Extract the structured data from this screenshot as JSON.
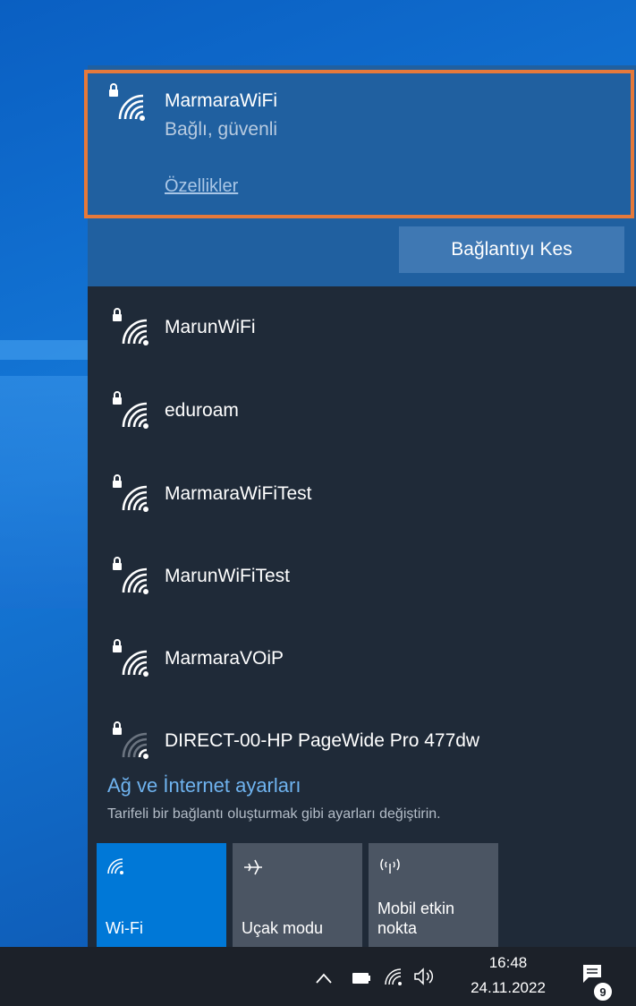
{
  "connected_network": {
    "name": "MarmaraWiFi",
    "status": "Bağlı, güvenli",
    "properties_link": "Özellikler",
    "disconnect_button": "Bağlantıyı Kes"
  },
  "networks": [
    {
      "name": "MarunWiFi",
      "secured": true,
      "signal": "full"
    },
    {
      "name": "eduroam",
      "secured": true,
      "signal": "full"
    },
    {
      "name": "MarmaraWiFiTest",
      "secured": true,
      "signal": "full"
    },
    {
      "name": "MarunWiFiTest",
      "secured": true,
      "signal": "full"
    },
    {
      "name": "MarmaraVOiP",
      "secured": true,
      "signal": "full"
    },
    {
      "name": "DIRECT-00-HP PageWide Pro 477dw",
      "secured": true,
      "signal": "weak"
    }
  ],
  "settings": {
    "link": "Ağ ve İnternet ayarları",
    "description": "Tarifeli bir bağlantı oluşturmak gibi ayarları değiştirin."
  },
  "quick_actions": [
    {
      "label": "Wi-Fi",
      "icon": "wifi-icon",
      "active": true
    },
    {
      "label": "Uçak modu",
      "icon": "airplane-icon",
      "active": false
    },
    {
      "label_line1": "Mobil etkin",
      "label_line2": "nokta",
      "icon": "mobile-hotspot-icon",
      "active": false
    }
  ],
  "taskbar": {
    "time": "16:48",
    "date": "24.11.2022",
    "notification_count": "9"
  },
  "colors": {
    "accent": "#0078d7",
    "connected_bg": "#2060a0",
    "panel_bg": "#1f2a38",
    "highlight_border": "#e6793a"
  }
}
